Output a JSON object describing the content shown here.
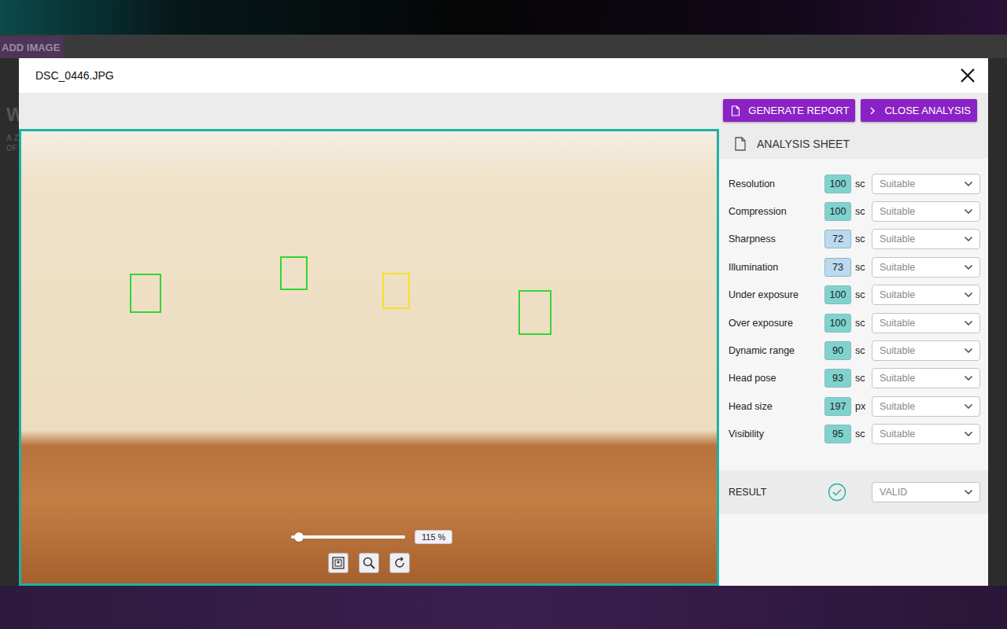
{
  "page": {
    "add_button": "ADD IMAGE",
    "background_texts": [
      "W",
      "A Z",
      "OF"
    ]
  },
  "modal": {
    "title": "DSC_0446.JPG"
  },
  "toolbar": {
    "buttons": [
      {
        "label": "GENERATE REPORT",
        "icon": "document"
      },
      {
        "label": "CLOSE ANALYSIS",
        "icon": "chevron"
      }
    ]
  },
  "viewer": {
    "faces": [
      {
        "color": "#35d435"
      },
      {
        "color": "#35d435"
      },
      {
        "color": "#f2e22a"
      },
      {
        "color": "#35d435"
      }
    ],
    "zoom": {
      "level": 0.04,
      "reading": "115 %"
    }
  },
  "sheet": {
    "title": "ANALYSIS SHEET",
    "rows": [
      {
        "label": "Resolution",
        "score": "100",
        "unit": "sc",
        "value": "Suitable",
        "color": "#7fd3ce"
      },
      {
        "label": "Compression",
        "score": "100",
        "unit": "sc",
        "value": "Suitable",
        "color": "#7fd3ce"
      },
      {
        "label": "Sharpness",
        "score": "72",
        "unit": "sc",
        "value": "Suitable",
        "color": "#bcd9ef"
      },
      {
        "label": "Illumination",
        "score": "73",
        "unit": "sc",
        "value": "Suitable",
        "color": "#bcd9ef"
      },
      {
        "label": "Under exposure",
        "score": "100",
        "unit": "sc",
        "value": "Suitable",
        "color": "#7fd3ce"
      },
      {
        "label": "Over exposure",
        "score": "100",
        "unit": "sc",
        "value": "Suitable",
        "color": "#7fd3ce"
      },
      {
        "label": "Dynamic range",
        "score": "90",
        "unit": "sc",
        "value": "Suitable",
        "color": "#7fd3ce"
      },
      {
        "label": "Head pose",
        "score": "93",
        "unit": "sc",
        "value": "Suitable",
        "color": "#7fd3ce"
      },
      {
        "label": "Head size",
        "score": "197",
        "unit": "px",
        "value": "Suitable",
        "color": "#7fd3ce"
      },
      {
        "label": "Visibility",
        "score": "95",
        "unit": "sc",
        "value": "Suitable",
        "color": "#7fd3ce"
      }
    ],
    "result": {
      "label": "RESULT",
      "value": "VALID",
      "valid": true
    }
  }
}
